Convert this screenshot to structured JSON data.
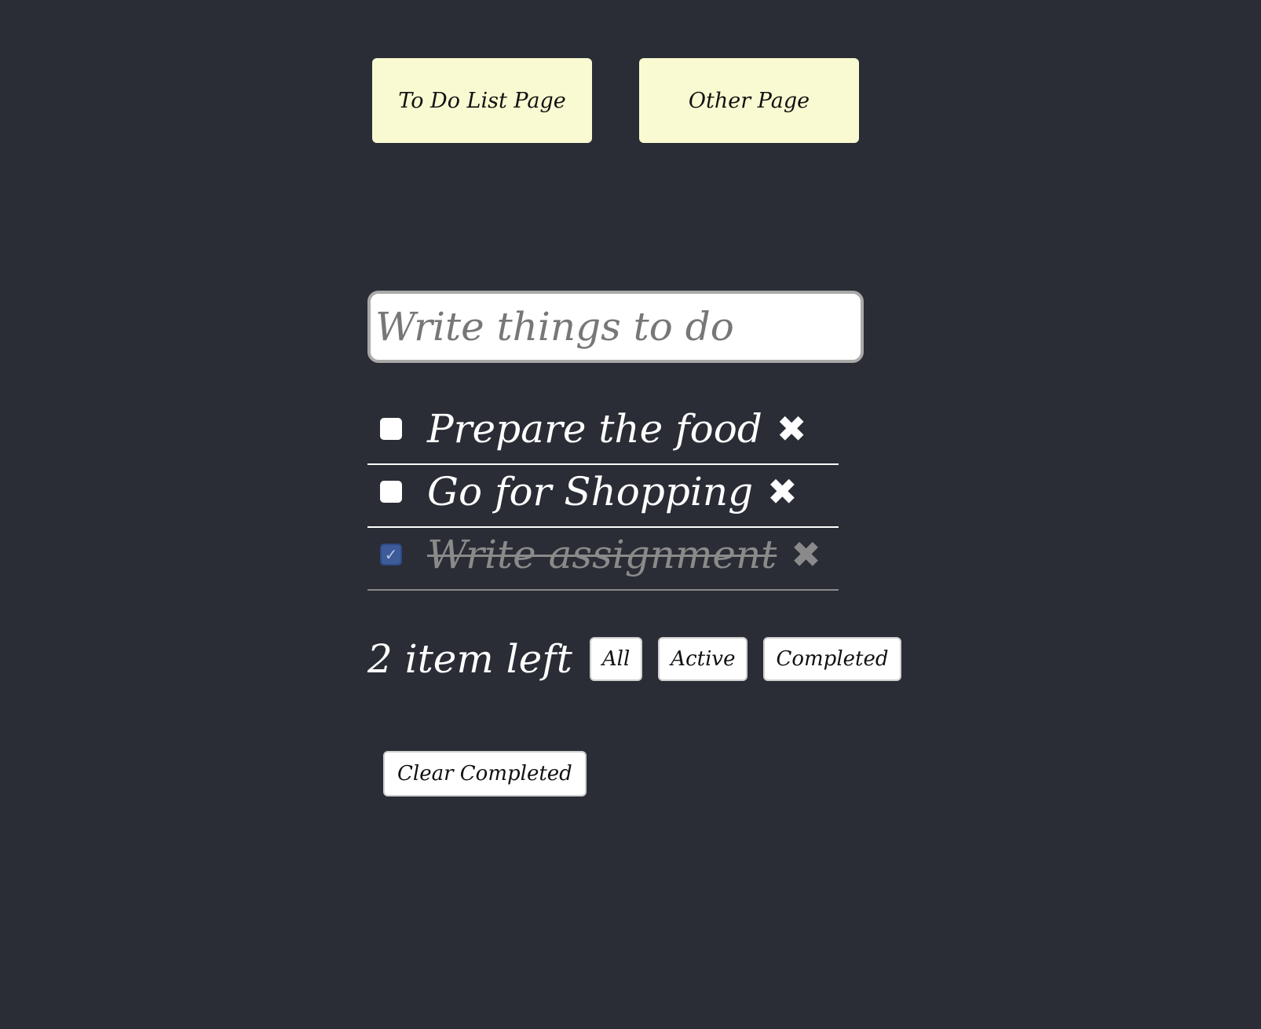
{
  "nav": {
    "todo_label": "To Do List Page",
    "other_label": "Other Page"
  },
  "input": {
    "placeholder": "Write things to do",
    "value": ""
  },
  "todos": [
    {
      "text": "Prepare the food",
      "completed": false,
      "delete_icon": "close-icon",
      "delete_glyph": "✖"
    },
    {
      "text": "Go for Shopping",
      "completed": false,
      "delete_icon": "close-icon",
      "delete_glyph": "✖"
    },
    {
      "text": "Write assignment",
      "completed": true,
      "delete_icon": "close-icon",
      "delete_glyph": "✖"
    }
  ],
  "footer": {
    "items_left": "2 item left",
    "filters": [
      "All",
      "Active",
      "Completed"
    ],
    "clear_label": "Clear Completed"
  },
  "colors": {
    "background": "#2a2d35",
    "nav_button": "#fafad2",
    "checkbox_checked": "#3d5a99",
    "completed_text": "#8a8a8a"
  }
}
